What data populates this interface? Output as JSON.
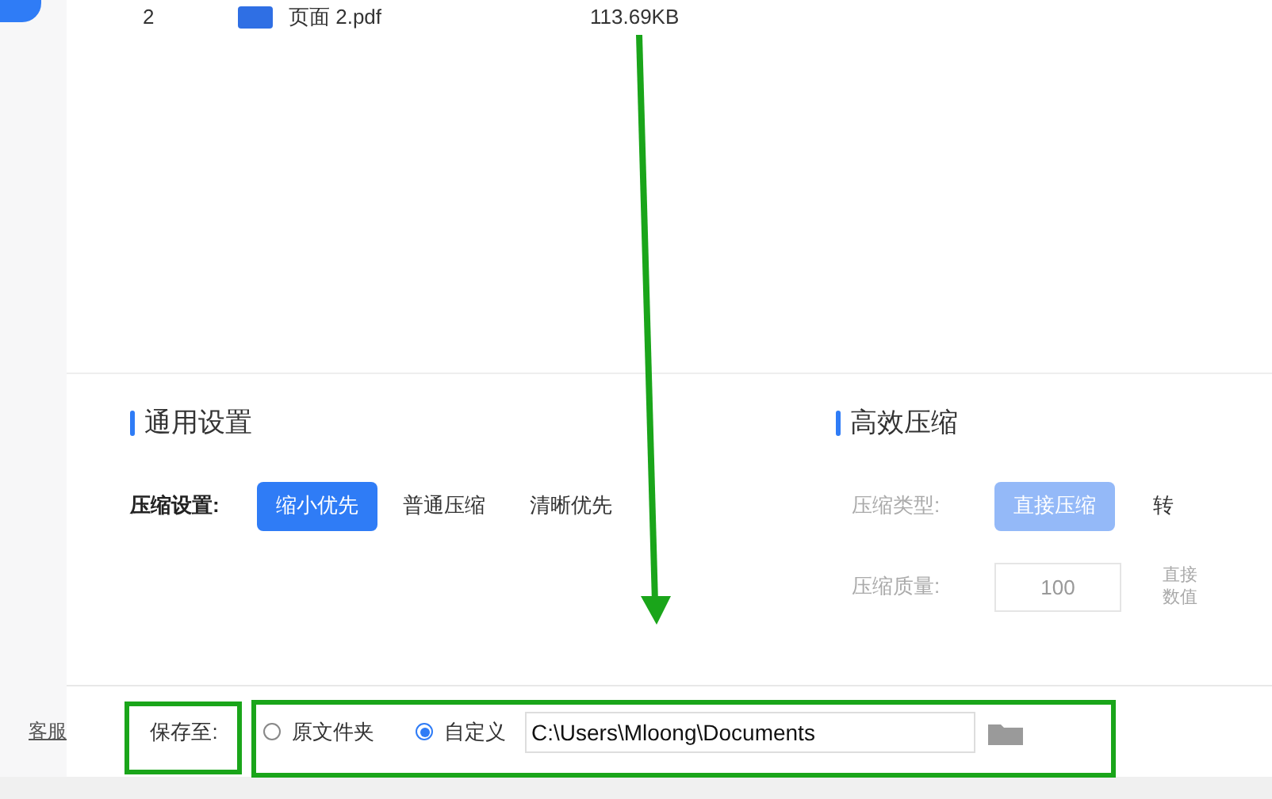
{
  "file_row": {
    "index": "2",
    "name": "页面 2.pdf",
    "size": "113.69KB"
  },
  "general": {
    "title": "通用设置",
    "label": "压缩设置:",
    "options": [
      {
        "label": "缩小优先",
        "selected": true
      },
      {
        "label": "普通压缩",
        "selected": false
      },
      {
        "label": "清晰优先",
        "selected": false
      }
    ]
  },
  "efficient": {
    "title": "高效压缩",
    "type_label": "压缩类型:",
    "types": [
      {
        "label": "直接压缩",
        "selected": true,
        "disabled": true
      },
      {
        "label": "转",
        "selected": false,
        "disabled": true
      }
    ],
    "quality_label": "压缩质量:",
    "quality": "100",
    "hint_lines": [
      "直接",
      "数值"
    ]
  },
  "sidebar": {
    "service_link": "客服"
  },
  "save": {
    "label": "保存至:",
    "options": [
      {
        "label": "原文件夹",
        "selected": false
      },
      {
        "label": "自定义",
        "selected": true
      }
    ],
    "path": "C:\\Users\\Mloong\\Documents"
  }
}
